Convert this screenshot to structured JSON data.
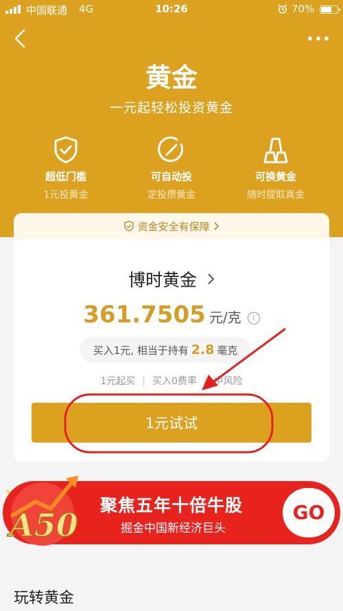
{
  "status_bar": {
    "carrier": "中国联通",
    "network": "4G",
    "time": "10:26",
    "battery": "70%",
    "battery_level": 0.7
  },
  "header": {
    "title": "黄金",
    "subtitle": "一元起轻松投资黄金"
  },
  "features": [
    {
      "icon": "shield-check-icon",
      "name": "超低门槛",
      "desc": "1元投黄金"
    },
    {
      "icon": "auto-invest-icon",
      "name": "可自动投",
      "desc": "定投攒黄金"
    },
    {
      "icon": "gold-bar-icon",
      "name": "可换黄金",
      "desc": "随时提取真金"
    }
  ],
  "card": {
    "security_note": "资金安全有保障",
    "fund_name": "博时黄金",
    "price": "361.7505",
    "price_unit": "元/克",
    "equiv_prefix": "买入1元, 相当于持有",
    "equiv_amount": "2.8",
    "equiv_unit": "毫克",
    "tags": [
      "1元起买",
      "买入0费率",
      "中风险"
    ],
    "buy_label": "1元试试"
  },
  "banner": {
    "logo_text": "A50",
    "title": "聚焦五年十倍牛股",
    "subtitle": "掘金中国新经济巨头",
    "go_label": "GO"
  },
  "section": {
    "title": "玩转黄金"
  },
  "colors": {
    "brand_gold": "#dca21f",
    "price_gold": "#d49d25",
    "banner_red": "#e8231e",
    "annotation_red": "#e5201c"
  }
}
